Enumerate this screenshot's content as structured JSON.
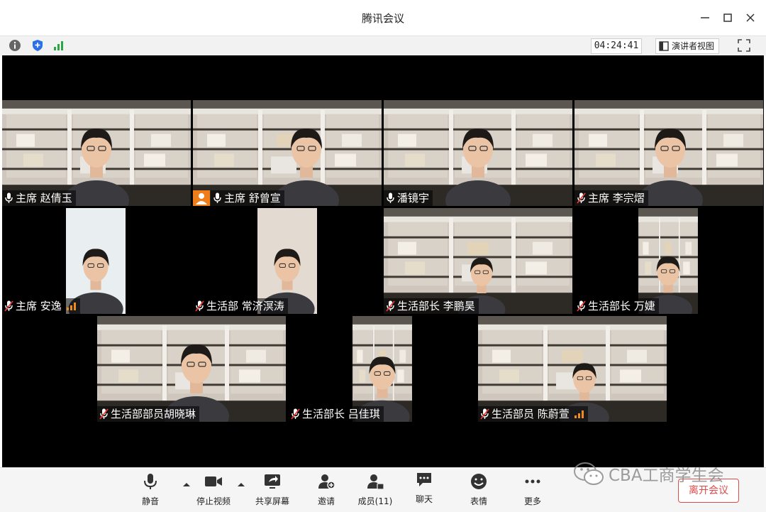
{
  "window": {
    "title": "腾讯会议"
  },
  "infobar": {
    "timer": "04:24:41",
    "speaker_view": "演讲者视图"
  },
  "participants": [
    {
      "name": "主席 赵倩玉",
      "muted": false,
      "active": true
    },
    {
      "name": "主席  舒曾宣",
      "muted": false,
      "host": true
    },
    {
      "name": "潘镜宇",
      "muted": false
    },
    {
      "name": "主席 李宗熠",
      "muted": true
    },
    {
      "name": "主席 安逸",
      "muted": true,
      "signal": true
    },
    {
      "name": "生活部 常济溟涛",
      "muted": true
    },
    {
      "name": "生活部长 李鹏昊",
      "muted": true
    },
    {
      "name": "生活部长 万婕",
      "muted": true
    },
    {
      "name": "生活部部员胡晓琳",
      "muted": true
    },
    {
      "name": "生活部长 吕佳琪",
      "muted": true
    },
    {
      "name": "生活部员 陈蔚萱",
      "muted": true,
      "signal": true
    }
  ],
  "toolbar": {
    "mute": "静音",
    "stop_video": "停止视频",
    "share_screen": "共享屏幕",
    "invite": "邀请",
    "members": "成员(11)",
    "chat": "聊天",
    "reactions": "表情",
    "more": "更多",
    "leave": "离开会议"
  },
  "watermark": "CBA工商学生会",
  "colors": {
    "accent_green": "#3bbd6a",
    "leave_red": "#e04a4a",
    "host_orange": "#ef7d1a"
  }
}
